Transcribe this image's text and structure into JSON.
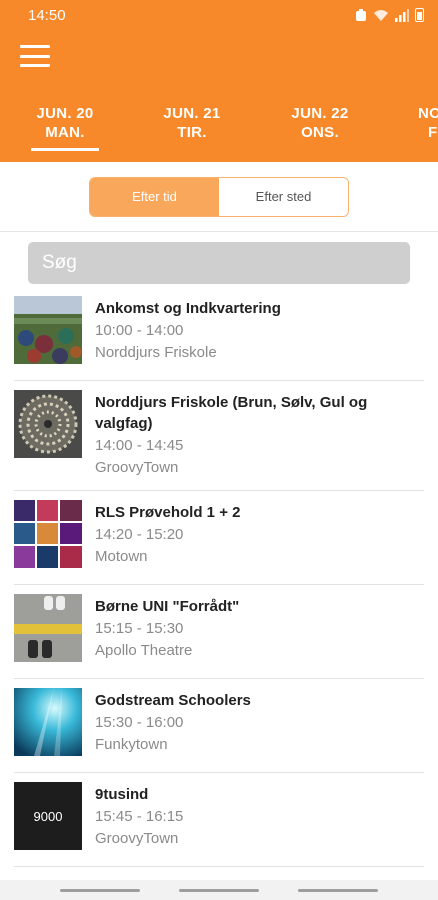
{
  "status_bar": {
    "time": "14:50"
  },
  "date_tabs": [
    {
      "date": "JUN. 20",
      "day": "MAN."
    },
    {
      "date": "JUN. 21",
      "day": "TIR."
    },
    {
      "date": "JUN. 22",
      "day": "ONS."
    },
    {
      "date": "NO",
      "day": "F"
    }
  ],
  "segment": {
    "by_time": "Efter tid",
    "by_place": "Efter sted"
  },
  "search": {
    "placeholder": "Søg"
  },
  "events": [
    {
      "title": "Ankomst og Indkvartering",
      "time": "10:00 - 14:00",
      "venue": "Norddjurs Friskole",
      "thumb": "crowd-tents-photo"
    },
    {
      "title": "Norddjurs Friskole (Brun, Sølv, Gul og valgfag)",
      "time": "14:00 - 14:45",
      "venue": "GroovyTown",
      "thumb": "spiral-art-photo"
    },
    {
      "title": "RLS Prøvehold 1 + 2",
      "time": "14:20 - 15:20",
      "venue": "Motown",
      "thumb": "photo-collage"
    },
    {
      "title": "Børne UNI \"Forrådt\"",
      "time": "15:15 - 15:30",
      "venue": "Apollo Theatre",
      "thumb": "shoes-on-line-photo"
    },
    {
      "title": "Godstream Schoolers",
      "time": "15:30 - 16:00",
      "venue": "Funkytown",
      "thumb": "blue-lights-photo"
    },
    {
      "title": "9tusind",
      "time": "15:45 - 16:15",
      "venue": "GroovyTown",
      "thumb_text": "9000"
    }
  ]
}
